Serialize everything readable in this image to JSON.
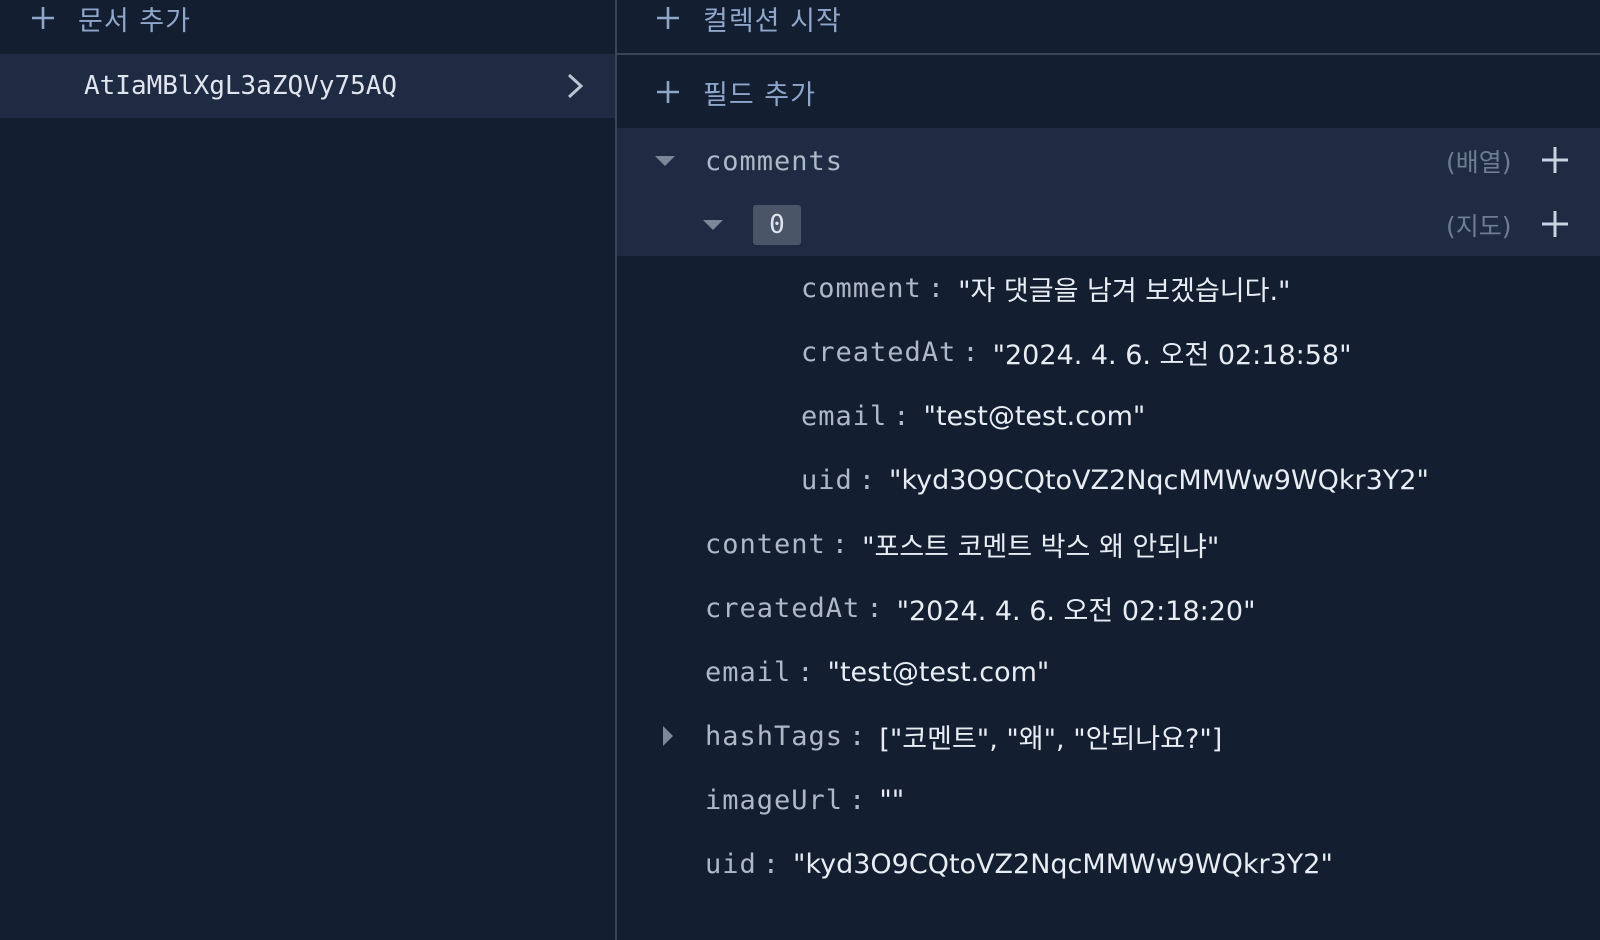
{
  "documents_panel": {
    "add_document_label": "문서 추가",
    "selected_document_id": "AtIaMBlXgL3aZQVy75AQ"
  },
  "fields_panel": {
    "start_collection_label": "컬렉션 시작",
    "add_field_label": "필드 추가",
    "comments": {
      "key": "comments",
      "type": "(배열)",
      "item": {
        "index": "0",
        "type": "(지도)",
        "fields": [
          {
            "key": "comment",
            "value": "\"자 댓글을 남겨 보겠습니다.\""
          },
          {
            "key": "createdAt",
            "value": "\"2024. 4. 6. 오전 02:18:58\""
          },
          {
            "key": "email",
            "value": "\"test@test.com\""
          },
          {
            "key": "uid",
            "value": "\"kyd3O9CQtoVZ2NqcMMWw9WQkr3Y2\""
          }
        ]
      }
    },
    "fields": [
      {
        "key": "content",
        "value": "\"포스트 코멘트 박스 왜 안되냐\""
      },
      {
        "key": "createdAt",
        "value": "\"2024. 4. 6. 오전 02:18:20\""
      },
      {
        "key": "email",
        "value": "\"test@test.com\""
      },
      {
        "key": "hashTags",
        "value": "[\"코멘트\", \"왜\", \"안되나요?\"]"
      },
      {
        "key": "imageUrl",
        "value": "\"\""
      },
      {
        "key": "uid",
        "value": "\"kyd3O9CQtoVZ2NqcMMWw9WQkr3Y2\""
      }
    ]
  },
  "colors": {
    "background": "#131e30",
    "highlight": "#1e2b42",
    "accent": "#8fa6cb",
    "divider": "#39465a"
  },
  "icons": [
    "plus-icon",
    "chevron-right-icon",
    "caret-down-icon",
    "caret-right-icon"
  ]
}
